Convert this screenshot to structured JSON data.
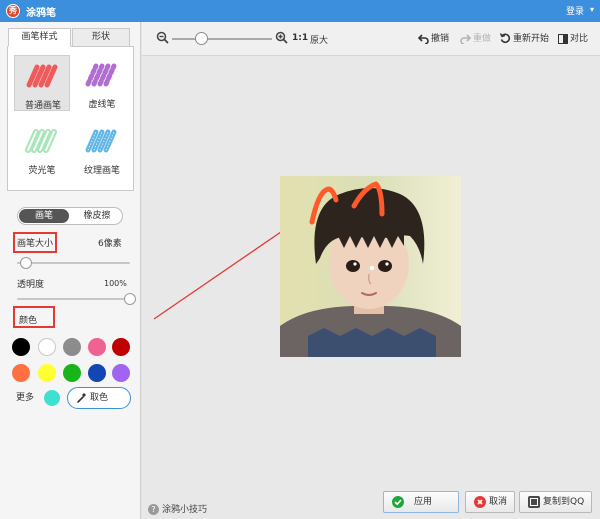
{
  "window": {
    "app_logo_text": "秀",
    "title": "涂鸦笔",
    "login_label": "登录"
  },
  "left_panel": {
    "tabs": [
      {
        "label": "画笔样式",
        "active": true
      },
      {
        "label": "形状",
        "active": false
      }
    ],
    "brushes": [
      {
        "label": "普通画笔",
        "color": "#f05a5a",
        "selected": true
      },
      {
        "label": "虚线笔",
        "color": "#b06fd0",
        "selected": false
      },
      {
        "label": "荧光笔",
        "color": "#90e0a8",
        "selected": false
      },
      {
        "label": "纹理画笔",
        "color": "#62b6e6",
        "selected": false
      }
    ],
    "mode_toggle": {
      "active_label": "画笔",
      "inactive_label": "橡皮擦"
    },
    "brush_size": {
      "label": "画笔大小",
      "value_text": "6像素",
      "level": 0.08
    },
    "opacity": {
      "label": "透明度",
      "value_text": "100%",
      "level": 1.0
    },
    "colors_label": "颜色",
    "swatches": [
      "#000000",
      "#ffffff",
      "#8c8c8c",
      "#f06292",
      "#c00000",
      "#ff7043",
      "#ffff33",
      "#19b419",
      "#1246b4",
      "#a064f0"
    ],
    "more_label": "更多",
    "more_color": "#40e0d0",
    "picker_label": "取色"
  },
  "toolbar": {
    "zoom_ratio": "1:1",
    "zoom_ratio_text": "原大",
    "undo_label": "撤销",
    "redo_label": "重做",
    "restart_label": "重新开始",
    "compare_label": "对比"
  },
  "footer": {
    "tips_label": "涂鸦小技巧",
    "apply_label": "应用",
    "cancel_label": "取消",
    "copy_qq_label": "复制到QQ"
  }
}
